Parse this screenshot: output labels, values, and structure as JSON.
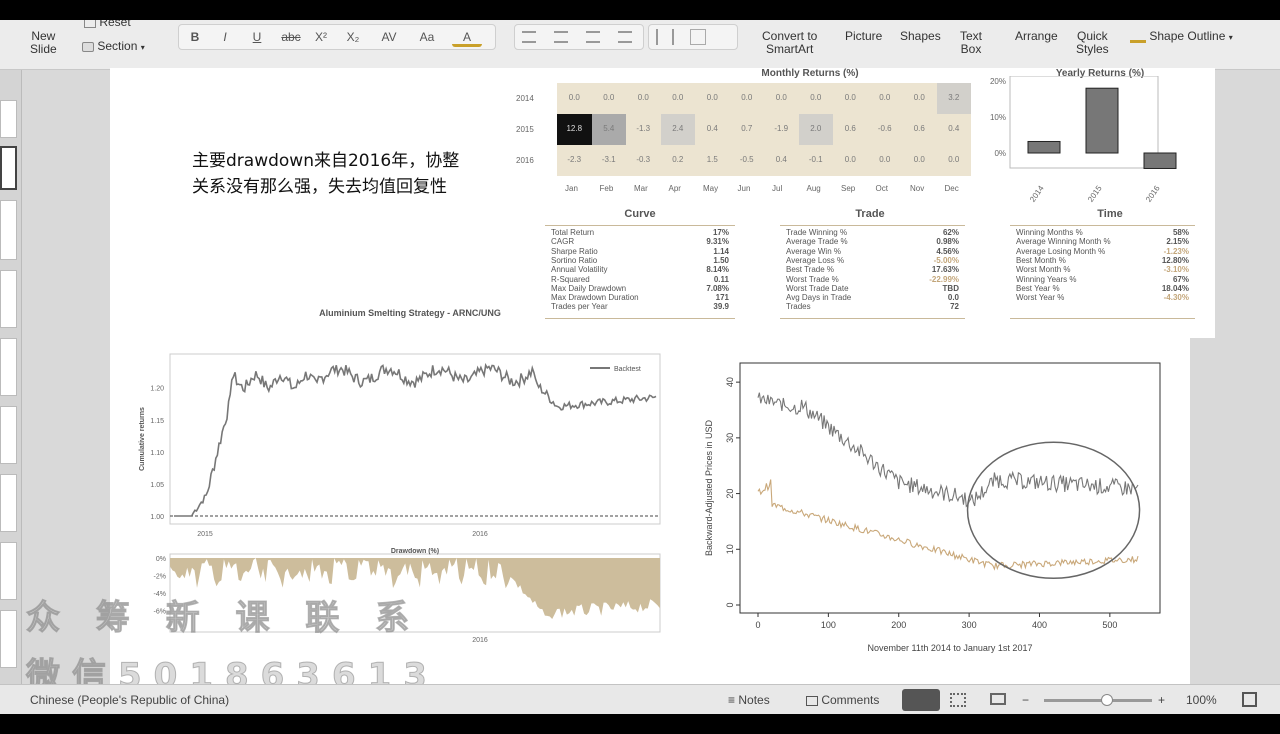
{
  "ribbon": {
    "new_slide": "New\nSlide",
    "reset": "Reset",
    "section": "Section",
    "convert_smartart": "Convert to\nSmartArt",
    "picture": "Picture",
    "shapes": "Shapes",
    "text_box": "Text\nBox",
    "arrange": "Arrange",
    "quick_styles": "Quick\nStyles",
    "shape_outline": "Shape Outline",
    "fmt_bold": "B",
    "fmt_italic": "I",
    "fmt_underline": "U",
    "fmt_strike": "abc",
    "fmt_super": "X²",
    "fmt_sub": "X₂",
    "fmt_spacing": "AV",
    "fmt_case": "Aa",
    "fmt_color": "A"
  },
  "slide": {
    "annotation_line1": "主要drawdown来自2016年，协整",
    "annotation_line2": "关系没有那么强，失去均值回复性",
    "monthly_title": "Monthly Returns (%)",
    "yearly_title": "Yearly Returns (%)",
    "curve_title": "Curve",
    "trade_title": "Trade",
    "time_title": "Time",
    "strategy_title": "Aluminium Smelting Strategy - ARNC/UNG",
    "legend_backtest": "Backtest",
    "cum_ylabel": "Cumulative returns",
    "drawdown_title": "Drawdown (%)",
    "prices_ylabel": "Backward-Adjusted Prices in USD",
    "prices_xlabel": "November 11th 2014 to January 1st 2017"
  },
  "heatmap": {
    "years": [
      "2014",
      "2015",
      "2016"
    ],
    "months": [
      "Jan",
      "Feb",
      "Mar",
      "Apr",
      "May",
      "Jun",
      "Jul",
      "Aug",
      "Sep",
      "Oct",
      "Nov",
      "Dec"
    ],
    "values": [
      [
        "0.0",
        "0.0",
        "0.0",
        "0.0",
        "0.0",
        "0.0",
        "0.0",
        "0.0",
        "0.0",
        "0.0",
        "0.0",
        "3.2"
      ],
      [
        "12.8",
        "5.4",
        "-1.3",
        "2.4",
        "0.4",
        "0.7",
        "-1.9",
        "2.0",
        "0.6",
        "-0.6",
        "0.6",
        "0.4"
      ],
      [
        "-2.3",
        "-3.1",
        "-0.3",
        "0.2",
        "1.5",
        "-0.5",
        "0.4",
        "-0.1",
        "0.0",
        "0.0",
        "0.0",
        "0.0"
      ]
    ]
  },
  "yearly": {
    "categories": [
      "2014",
      "2015",
      "2016"
    ],
    "values": [
      3.2,
      18.0,
      -4.3
    ],
    "yticks": [
      "20%",
      "10%",
      "0%"
    ]
  },
  "curve_stats": [
    [
      "Total Return",
      "17%"
    ],
    [
      "CAGR",
      "9.31%"
    ],
    [
      "Sharpe Ratio",
      "1.14"
    ],
    [
      "Sortino Ratio",
      "1.50"
    ],
    [
      "Annual Volatility",
      "8.14%"
    ],
    [
      "R-Squared",
      "0.11"
    ],
    [
      "Max Daily Drawdown",
      "7.08%"
    ],
    [
      "Max Drawdown Duration",
      "171"
    ],
    [
      "Trades per Year",
      "39.9"
    ]
  ],
  "trade_stats": [
    [
      "Trade Winning %",
      "62%"
    ],
    [
      "Average Trade %",
      "0.98%"
    ],
    [
      "Average Win %",
      "4.56%"
    ],
    [
      "Average Loss %",
      "-5.00%"
    ],
    [
      "Best Trade %",
      "17.63%"
    ],
    [
      "Worst Trade %",
      "-22.99%"
    ],
    [
      "Worst Trade Date",
      "TBD"
    ],
    [
      "Avg Days in Trade",
      "0.0"
    ],
    [
      "Trades",
      "72"
    ]
  ],
  "time_stats": [
    [
      "Winning Months %",
      "58%"
    ],
    [
      "Average Winning Month %",
      "2.15%"
    ],
    [
      "Average Losing Month %",
      "-1.23%"
    ],
    [
      "Best Month %",
      "12.80%"
    ],
    [
      "Worst Month %",
      "-3.10%"
    ],
    [
      "Winning Years %",
      "67%"
    ],
    [
      "Best Year %",
      "18.04%"
    ],
    [
      "Worst Year %",
      "-4.30%"
    ]
  ],
  "cum_axis": {
    "yticks": [
      "1.20",
      "1.15",
      "1.10",
      "1.05",
      "1.00"
    ],
    "xticks": [
      "2015",
      "2016"
    ]
  },
  "dd_axis": {
    "yticks": [
      "0%",
      "-2%",
      "-4%",
      "-6%"
    ],
    "xticks": [
      "2016"
    ]
  },
  "prices_axis": {
    "yticks": [
      "40",
      "30",
      "20",
      "10",
      "0"
    ],
    "xticks": [
      "0",
      "100",
      "200",
      "300",
      "400",
      "500"
    ]
  },
  "watermark": {
    "line1": "众 筹 新 课 联 系",
    "line2": "微信501863613"
  },
  "status": {
    "language": "Chinese (People's Republic of China)",
    "notes": "Notes",
    "comments": "Comments",
    "zoom": "100%",
    "zoom_level": 0.58
  },
  "colors": {
    "accent": "#8c7a52",
    "heat_dark": "#111111",
    "bar": "#666666"
  }
}
